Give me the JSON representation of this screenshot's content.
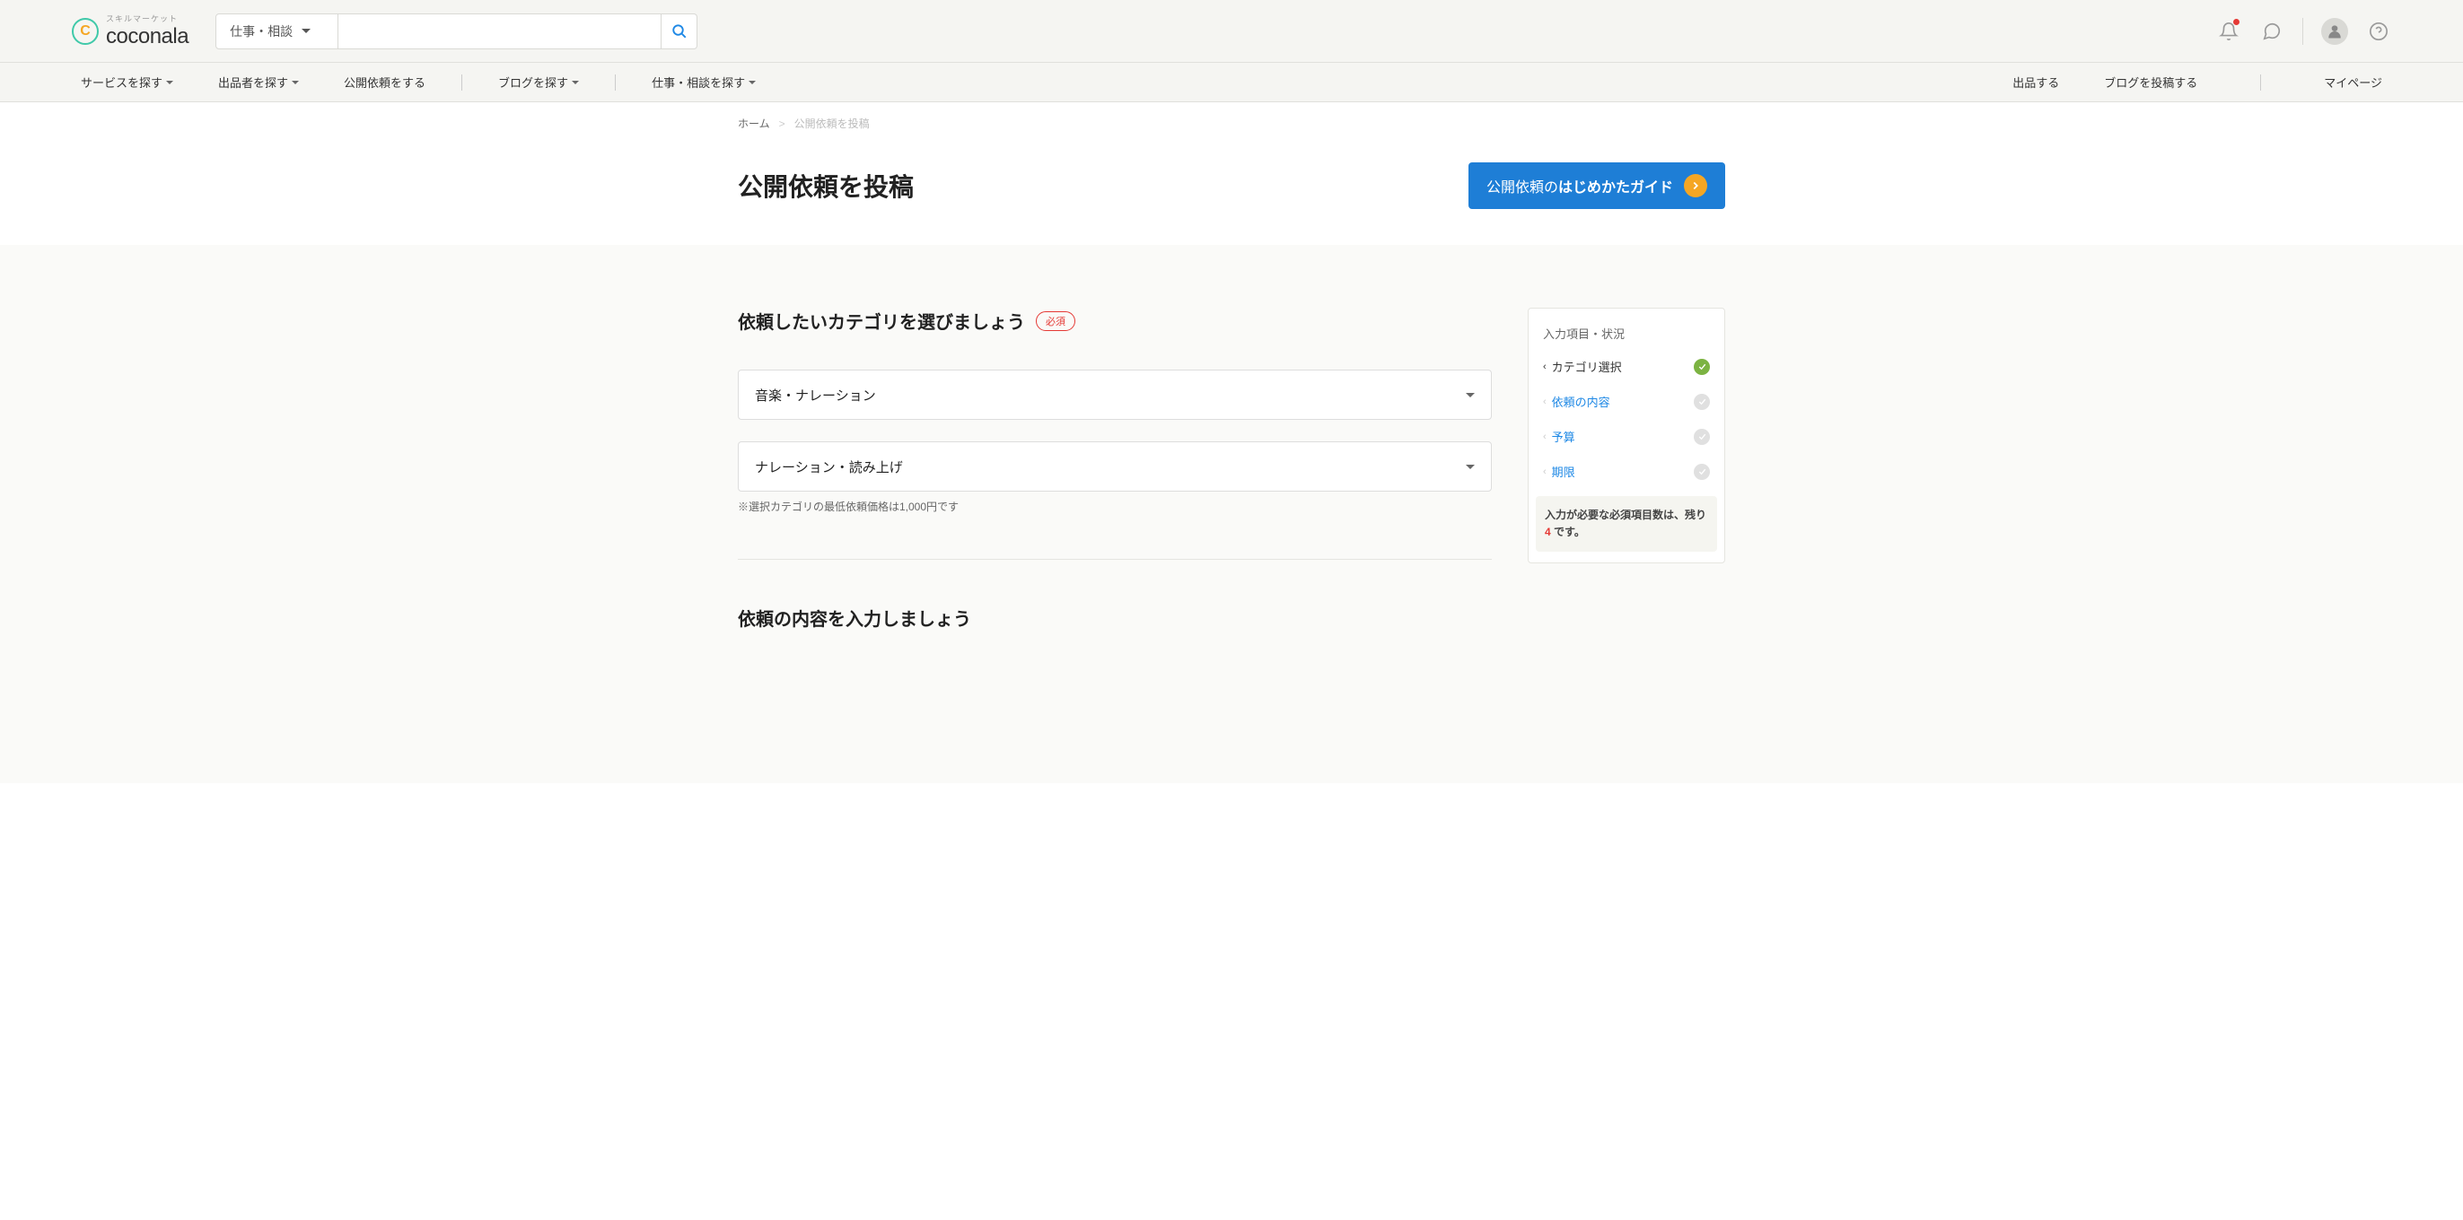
{
  "header": {
    "logo_tagline": "スキルマーケット",
    "logo_text": "coconala",
    "search_select": "仕事・相談",
    "search_placeholder": ""
  },
  "nav": {
    "service": "サービスを探す",
    "seller": "出品者を探す",
    "request": "公開依頼をする",
    "blog": "ブログを探す",
    "job": "仕事・相談を探す",
    "sell": "出品する",
    "post_blog": "ブログを投稿する",
    "mypage": "マイページ"
  },
  "breadcrumb": {
    "home": "ホーム",
    "current": "公開依頼を投稿"
  },
  "title": "公開依頼を投稿",
  "guide": {
    "prefix": "公開依頼の",
    "bold": "はじめかたガイド"
  },
  "section1": {
    "heading": "依頼したいカテゴリを選びましょう",
    "required": "必須",
    "select1": "音楽・ナレーション",
    "select2": "ナレーション・読み上げ",
    "note": "※選択カテゴリの最低依頼価格は1,000円です"
  },
  "section2": {
    "heading": "依頼の内容を入力しましょう"
  },
  "sidebar": {
    "title": "入力項目・状況",
    "items": [
      {
        "label": "カテゴリ選択",
        "done": true,
        "active": true
      },
      {
        "label": "依頼の内容",
        "done": false,
        "active": false
      },
      {
        "label": "予算",
        "done": false,
        "active": false
      },
      {
        "label": "期限",
        "done": false,
        "active": false
      }
    ],
    "footer_prefix": "入力が必要な必須項目数は、残り ",
    "footer_count": "4",
    "footer_suffix": " です。"
  }
}
